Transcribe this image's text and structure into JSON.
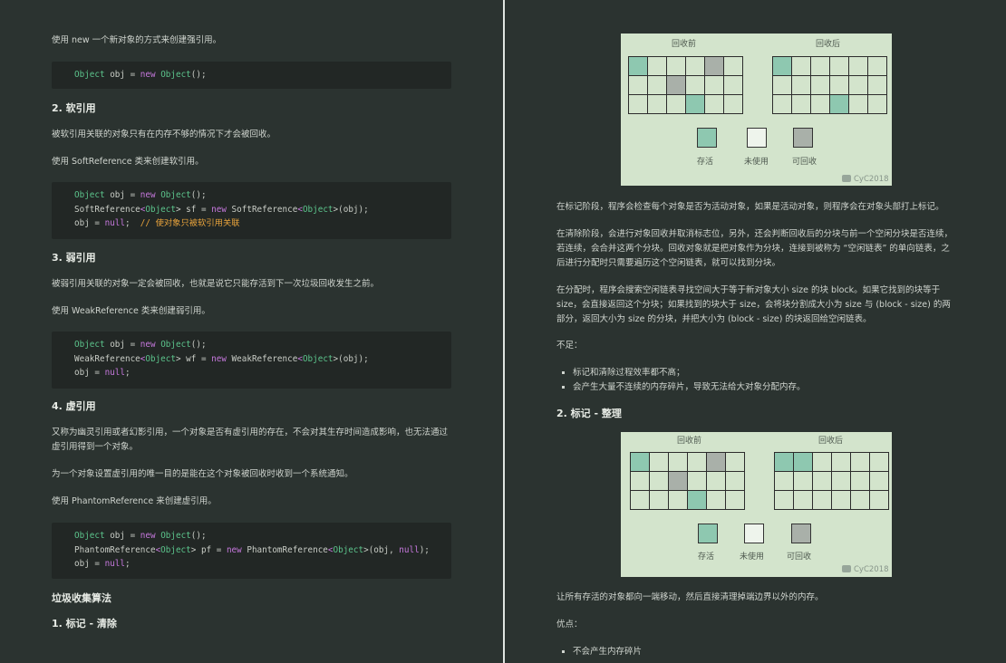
{
  "left": {
    "strong_intro": "使用 new 一个新对象的方式来创建强引用。",
    "strong_code": [
      [
        {
          "t": "Object",
          "c": "ty"
        },
        {
          "t": " obj = "
        },
        {
          "t": "new",
          "c": "kw"
        },
        {
          "t": " "
        },
        {
          "t": "Object",
          "c": "ty"
        },
        {
          "t": "();"
        }
      ]
    ],
    "soft_heading": "2. 软引用",
    "soft_p1": "被软引用关联的对象只有在内存不够的情况下才会被回收。",
    "soft_p2": "使用 SoftReference 类来创建软引用。",
    "soft_code": [
      [
        {
          "t": "Object",
          "c": "ty"
        },
        {
          "t": " obj = "
        },
        {
          "t": "new",
          "c": "kw"
        },
        {
          "t": " "
        },
        {
          "t": "Object",
          "c": "ty"
        },
        {
          "t": "();"
        }
      ],
      [
        {
          "t": "SoftReference"
        },
        {
          "t": "<",
          "c": "kw"
        },
        {
          "t": "Object",
          "c": "ty"
        },
        {
          "t": "> sf = "
        },
        {
          "t": "new",
          "c": "kw"
        },
        {
          "t": " SoftReference"
        },
        {
          "t": "<",
          "c": "kw"
        },
        {
          "t": "Object",
          "c": "ty"
        },
        {
          "t": ">(obj);"
        }
      ],
      [
        {
          "t": "obj = "
        },
        {
          "t": "null",
          "c": "nu"
        },
        {
          "t": ";  "
        },
        {
          "t": "// 使对象只被软引用关联",
          "c": "cm"
        }
      ]
    ],
    "weak_heading": "3. 弱引用",
    "weak_p1": "被弱引用关联的对象一定会被回收，也就是说它只能存活到下一次垃圾回收发生之前。",
    "weak_p2": "使用 WeakReference 类来创建弱引用。",
    "weak_code": [
      [
        {
          "t": "Object",
          "c": "ty"
        },
        {
          "t": " obj = "
        },
        {
          "t": "new",
          "c": "kw"
        },
        {
          "t": " "
        },
        {
          "t": "Object",
          "c": "ty"
        },
        {
          "t": "();"
        }
      ],
      [
        {
          "t": "WeakReference"
        },
        {
          "t": "<",
          "c": "kw"
        },
        {
          "t": "Object",
          "c": "ty"
        },
        {
          "t": "> wf = "
        },
        {
          "t": "new",
          "c": "kw"
        },
        {
          "t": " WeakReference"
        },
        {
          "t": "<",
          "c": "kw"
        },
        {
          "t": "Object",
          "c": "ty"
        },
        {
          "t": ">(obj);"
        }
      ],
      [
        {
          "t": "obj = "
        },
        {
          "t": "null",
          "c": "nu"
        },
        {
          "t": ";"
        }
      ]
    ],
    "phantom_heading": "4. 虚引用",
    "phantom_p1": "又称为幽灵引用或者幻影引用，一个对象是否有虚引用的存在，不会对其生存时间造成影响，也无法通过虚引用得到一个对象。",
    "phantom_p2": "为一个对象设置虚引用的唯一目的是能在这个对象被回收时收到一个系统通知。",
    "phantom_p3": "使用 PhantomReference 来创建虚引用。",
    "phantom_code": [
      [
        {
          "t": "Object",
          "c": "ty"
        },
        {
          "t": " obj = "
        },
        {
          "t": "new",
          "c": "kw"
        },
        {
          "t": " "
        },
        {
          "t": "Object",
          "c": "ty"
        },
        {
          "t": "();"
        }
      ],
      [
        {
          "t": "PhantomReference"
        },
        {
          "t": "<",
          "c": "kw"
        },
        {
          "t": "Object",
          "c": "ty"
        },
        {
          "t": "> pf = "
        },
        {
          "t": "new",
          "c": "kw"
        },
        {
          "t": " PhantomReference"
        },
        {
          "t": "<",
          "c": "kw"
        },
        {
          "t": "Object",
          "c": "ty"
        },
        {
          "t": ">(obj, "
        },
        {
          "t": "null",
          "c": "nu"
        },
        {
          "t": ");"
        }
      ],
      [
        {
          "t": "obj = "
        },
        {
          "t": "null",
          "c": "nu"
        },
        {
          "t": ";"
        }
      ]
    ],
    "gc_heading": "垃圾收集算法",
    "ms_heading": "1. 标记 - 清除"
  },
  "right": {
    "fig1": {
      "before": "回收前",
      "after": "回收后",
      "before_grid": [
        [
          "live",
          "",
          "",
          "",
          "recl",
          ""
        ],
        [
          "",
          "",
          "recl",
          "",
          "",
          ""
        ],
        [
          "",
          "",
          "",
          "live",
          "",
          ""
        ]
      ],
      "after_grid": [
        [
          "live",
          "",
          "",
          "",
          "",
          ""
        ],
        [
          "",
          "",
          "",
          "",
          "",
          ""
        ],
        [
          "",
          "",
          "",
          "live",
          "",
          ""
        ]
      ],
      "legend": [
        "存活",
        "未使用",
        "可回收"
      ],
      "watermark": "CyC2018"
    },
    "p1": "在标记阶段，程序会检查每个对象是否为活动对象，如果是活动对象，则程序会在对象头部打上标记。",
    "p2": "在清除阶段，会进行对象回收并取消标志位，另外，还会判断回收后的分块与前一个空闲分块是否连续，若连续，会合并这两个分块。回收对象就是把对象作为分块，连接到被称为 “空闲链表” 的单向链表，之后进行分配时只需要遍历这个空闲链表，就可以找到分块。",
    "p3": "在分配时，程序会搜索空闲链表寻找空间大于等于新对象大小 size 的块 block。如果它找到的块等于 size，会直接返回这个分块；如果找到的块大于 size，会将块分割成大小为 size 与 (block - size) 的两部分，返回大小为 size 的分块，并把大小为 (block - size) 的块返回给空闲链表。",
    "cons_label": "不足：",
    "cons": [
      "标记和清除过程效率都不高；",
      "会产生大量不连续的内存碎片，导致无法给大对象分配内存。"
    ],
    "mc_heading": "2. 标记 - 整理",
    "fig2": {
      "before": "回收前",
      "after": "回收后",
      "before_grid": [
        [
          "live",
          "",
          "",
          "",
          "recl",
          ""
        ],
        [
          "",
          "",
          "recl",
          "",
          "",
          ""
        ],
        [
          "",
          "",
          "",
          "live",
          "",
          ""
        ]
      ],
      "after_grid": [
        [
          "live",
          "live",
          "",
          "",
          "",
          ""
        ],
        [
          "",
          "",
          "",
          "",
          "",
          ""
        ],
        [
          "",
          "",
          "",
          "",
          "",
          ""
        ]
      ],
      "legend": [
        "存活",
        "未使用",
        "可回收"
      ],
      "watermark": "CyC2018"
    },
    "p4": "让所有存活的对象都向一端移动，然后直接清理掉端边界以外的内存。",
    "pros_label": "优点：",
    "pros": [
      "不会产生内存碎片"
    ]
  },
  "colors": {
    "background": "#2b3330",
    "figure": "#d3e4cc",
    "live": "#8ec8b0",
    "reclaim": "#a9b0a9",
    "code_bg": "#222725"
  }
}
